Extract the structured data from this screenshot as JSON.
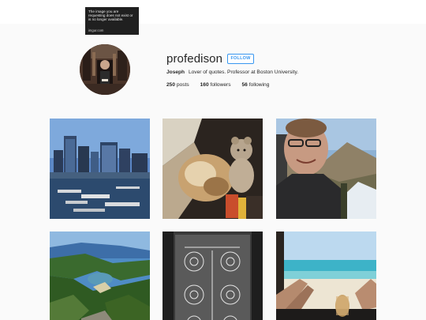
{
  "notice": {
    "message": "The image you are requesting does not exist or is no longer available.",
    "source": "imgur.com"
  },
  "profile": {
    "username": "profedison",
    "follow_label": "FOLLOW",
    "display_name": "Joseph",
    "bio": "Lover of quotes. Professor at Boston University.",
    "stats": [
      {
        "count": "250",
        "label": "posts"
      },
      {
        "count": "160",
        "label": "followers"
      },
      {
        "count": "56",
        "label": "following"
      }
    ]
  },
  "posts": [
    {
      "subject": "city-waterfront"
    },
    {
      "subject": "dog-with-teddy-bear"
    },
    {
      "subject": "selfie-with-glasses"
    },
    {
      "subject": "coastline-aerial"
    },
    {
      "subject": "patent-drawing"
    },
    {
      "subject": "beach-feet-view"
    }
  ]
}
